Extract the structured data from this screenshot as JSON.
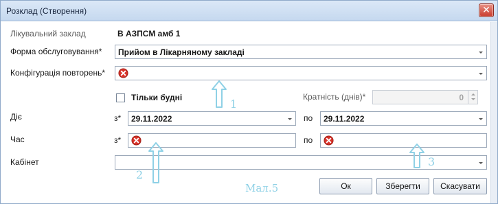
{
  "window": {
    "title": "Розклад (Створення)",
    "close_glyph": "✕"
  },
  "form": {
    "facility": {
      "label": "Лікувальний заклад",
      "value": "В АЗПСМ амб 1"
    },
    "service_form": {
      "label": "Форма обслуговування*",
      "value": "Прийом в Лікарняному закладі"
    },
    "repeat_config": {
      "label": "Конфігурація повторень*",
      "value": ""
    },
    "weekdays_only": {
      "label": "Тільки будні",
      "checked": false
    },
    "multiplicity": {
      "label": "Кратність (днів)*",
      "value": "0"
    },
    "valid": {
      "label": "Діє",
      "from_label": "з*",
      "from_value": "29.11.2022",
      "to_label": "по",
      "to_value": "29.11.2022"
    },
    "time": {
      "label": "Час",
      "from_label": "з*",
      "to_label": "по"
    },
    "cabinet": {
      "label": "Кабінет",
      "value": ""
    }
  },
  "buttons": {
    "ok": "Ок",
    "save": "Зберегти",
    "cancel": "Скасувати"
  },
  "annotations": {
    "n1": "1",
    "n2": "2",
    "n3": "3",
    "caption": "Мал.5"
  },
  "colors": {
    "annotation": "#8fd1e6",
    "error": "#d9342b"
  }
}
